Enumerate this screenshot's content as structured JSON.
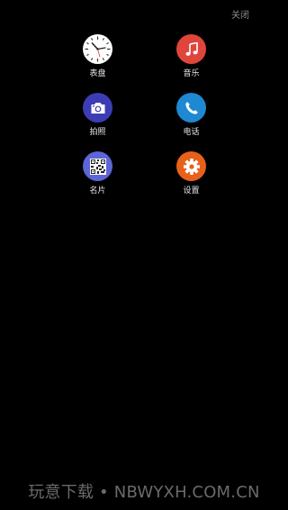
{
  "header": {
    "close_label": "关闭"
  },
  "apps": [
    {
      "label": "表盘",
      "icon": "clock-icon",
      "color": "#ffffff"
    },
    {
      "label": "音乐",
      "icon": "music-note-icon",
      "color": "#e0453c"
    },
    {
      "label": "拍照",
      "icon": "camera-icon",
      "color": "#3c3db5"
    },
    {
      "label": "电话",
      "icon": "phone-icon",
      "color": "#1e88d2"
    },
    {
      "label": "名片",
      "icon": "qr-code-icon",
      "color": "#5d66d6"
    },
    {
      "label": "设置",
      "icon": "gear-icon",
      "color": "#e8611a"
    }
  ],
  "watermark": "玩意下载 • NBWYXH.COM.CN"
}
